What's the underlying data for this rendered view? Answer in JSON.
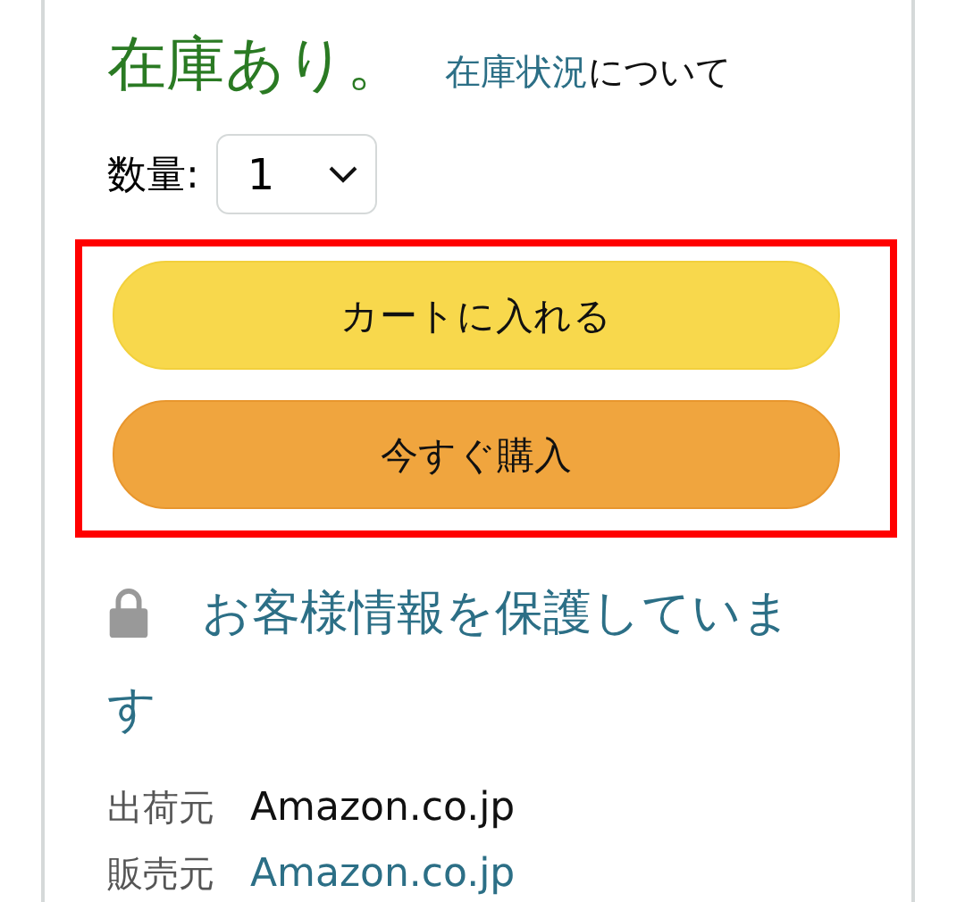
{
  "stock": {
    "status": "在庫あり。",
    "link": "在庫状況",
    "link_suffix": "について"
  },
  "quantity": {
    "label": "数量:",
    "value": "1"
  },
  "highlight": {
    "on": true
  },
  "buttons": [
    {
      "label": "カートに入れる",
      "kind": "cart"
    },
    {
      "label": "今すぐ購入",
      "kind": "buy"
    }
  ],
  "secure": {
    "text": "お客様情報を保護しています"
  },
  "details": [
    {
      "label": "出荷元",
      "value": "Amazon.co.jp",
      "link": false
    },
    {
      "label": "販売元",
      "value": "Amazon.co.jp",
      "link": true
    }
  ]
}
